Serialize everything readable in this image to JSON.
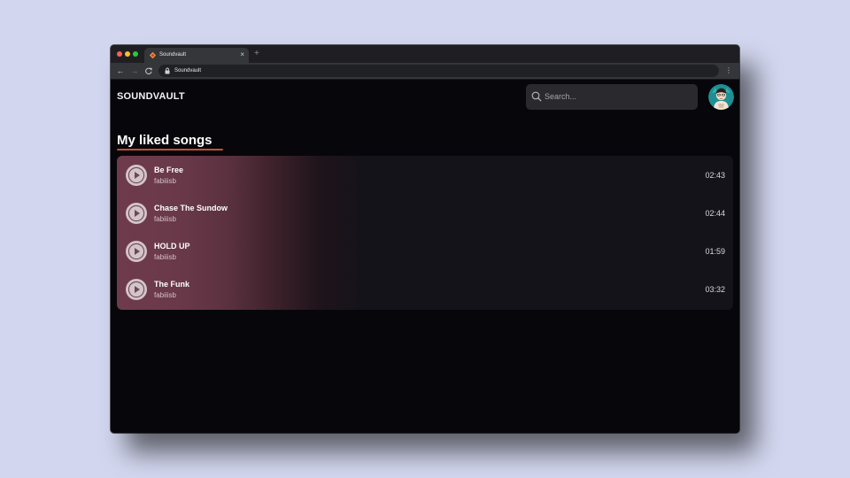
{
  "browser": {
    "tab_title": "Soundvault",
    "close_glyph": "×",
    "new_tab_glyph": "+",
    "url": "Soundvault",
    "back_glyph": "←",
    "forward_glyph": "→",
    "reload_glyph": "C",
    "menu_glyph": "⋮"
  },
  "header": {
    "brand": "SOUNDVAULT",
    "search_placeholder": "Search...",
    "search_icon": "search-icon",
    "avatar_icon": "user-avatar"
  },
  "main": {
    "title": "My liked songs",
    "songs": [
      {
        "title": "Be Free",
        "artist": "fabiiisb",
        "duration": "02:43"
      },
      {
        "title": "Chase The Sundow",
        "artist": "fabiiisb",
        "duration": "02:44"
      },
      {
        "title": "HOLD UP",
        "artist": "fabiiisb",
        "duration": "01:59"
      },
      {
        "title": "The Funk",
        "artist": "fabiiisb",
        "duration": "03:32"
      }
    ]
  },
  "colors": {
    "background": "#d2d6ee",
    "app_bg": "#07060b",
    "accent_underline": "#c8502e",
    "list_gradient_start": "#6e3b4c",
    "list_bg": "#141319",
    "search_bg": "#2a292e"
  }
}
